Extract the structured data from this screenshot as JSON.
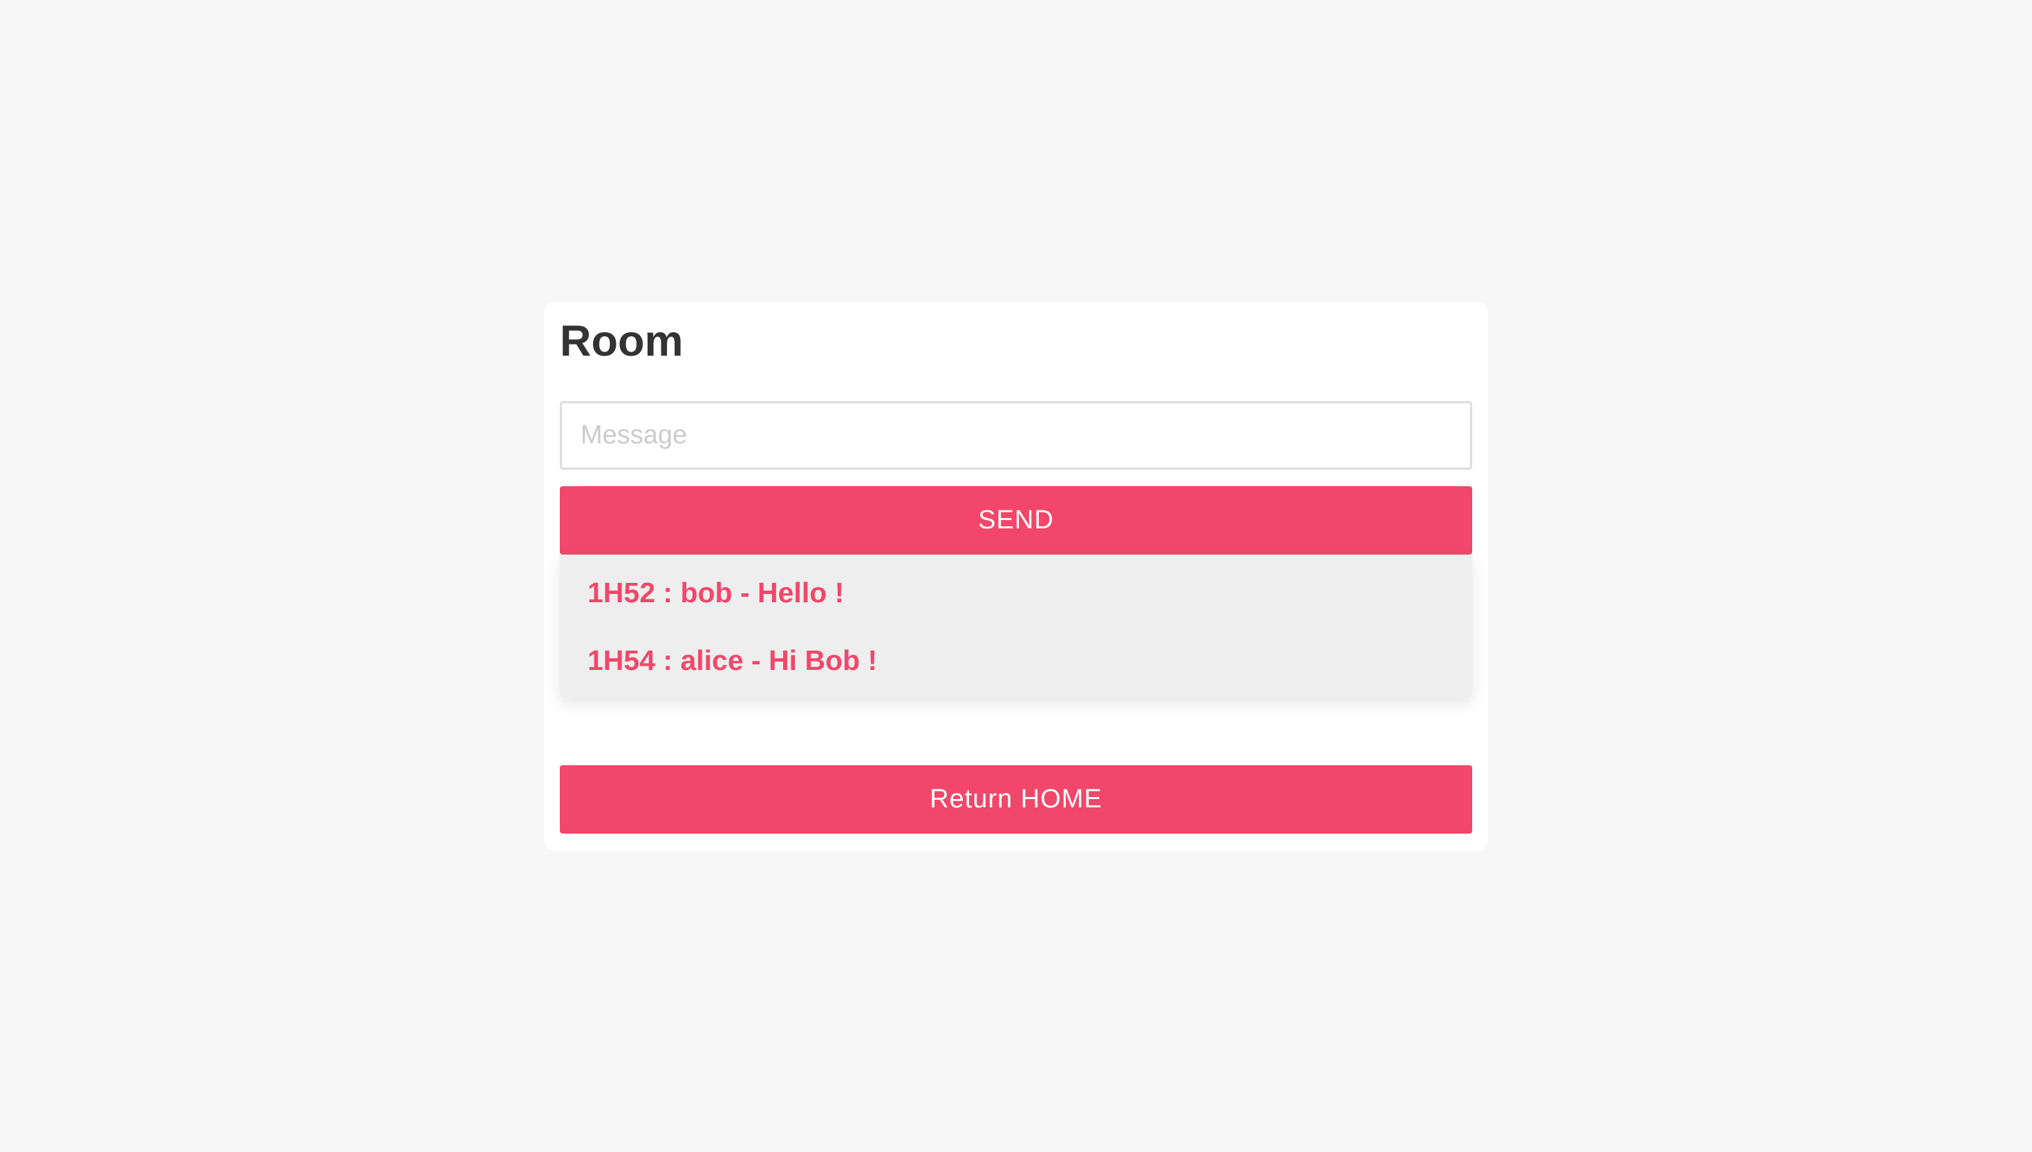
{
  "room": {
    "title": "Room",
    "message_input": {
      "placeholder": "Message",
      "value": ""
    },
    "send_label": "SEND",
    "messages": [
      "1H52 : bob - Hello !",
      "1H54 : alice - Hi Bob !"
    ],
    "return_label": "Return HOME"
  },
  "colors": {
    "accent": "#f2476a",
    "background": "#f7f7f7",
    "card": "#ffffff",
    "message_list_bg": "#eeeeee",
    "title_text": "#333333"
  }
}
